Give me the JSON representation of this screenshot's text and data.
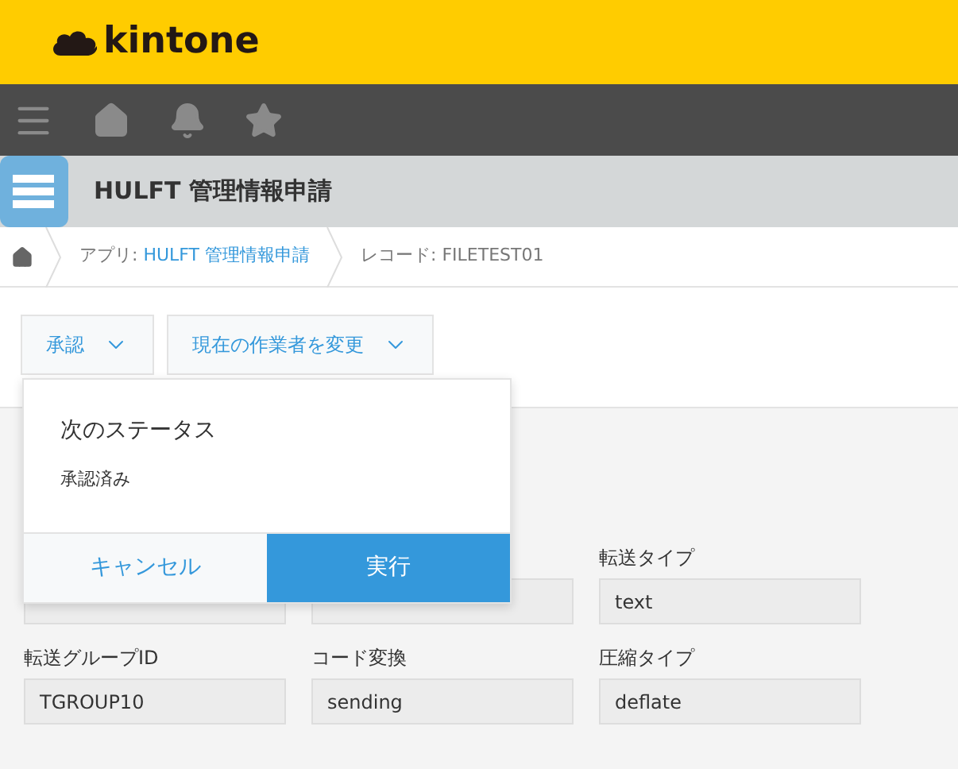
{
  "header": {
    "logo": "kintone"
  },
  "app_title": "HULFT 管理情報申請",
  "breadcrumb": [
    {
      "kind": "home"
    },
    {
      "kind": "app",
      "prefix": "アプリ: ",
      "link": "HULFT 管理情報申請"
    },
    {
      "kind": "record",
      "text": "レコード: FILETEST01"
    }
  ],
  "actions": [
    {
      "label": "承認"
    },
    {
      "label": "現在の作業者を変更"
    }
  ],
  "popup": {
    "heading": "次のステータス",
    "status": "承認済み",
    "cancel": "キャンセル",
    "submit": "実行"
  },
  "fields": [
    [
      {
        "kind": "covered"
      },
      {
        "kind": "covered"
      },
      {
        "kind": "text",
        "label": "転送タイプ",
        "value": "text"
      }
    ],
    [
      {
        "kind": "text",
        "label": "転送グループID",
        "value": "TGROUP10"
      },
      {
        "kind": "text",
        "label": "コード変換",
        "value": "sending"
      },
      {
        "kind": "text",
        "label": "圧縮タイプ",
        "value": "deflate"
      }
    ]
  ]
}
